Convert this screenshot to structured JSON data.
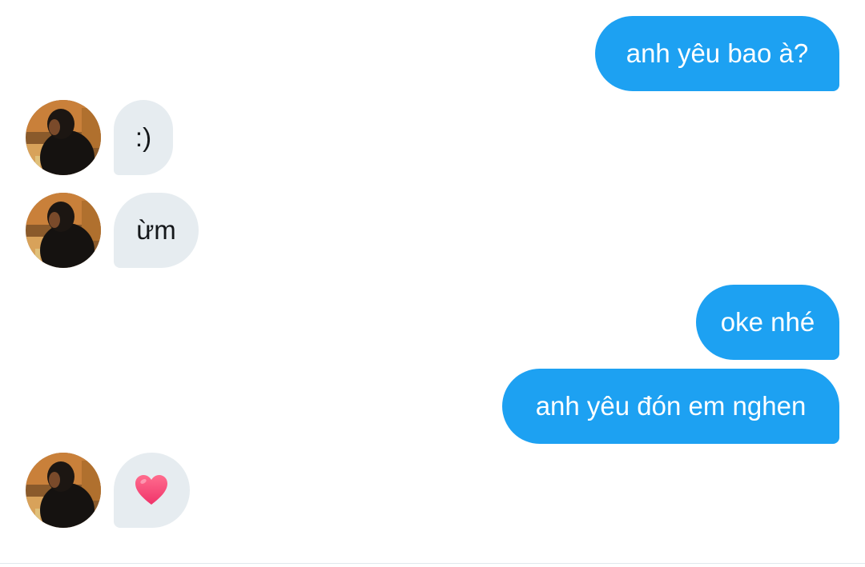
{
  "colors": {
    "sent_bubble": "#1da1f2",
    "sent_text": "#ffffff",
    "received_bubble": "#e6ecf0",
    "received_text": "#14171a",
    "divider": "#e1e8ed"
  },
  "messages": [
    {
      "sender": "me",
      "text": "anh yêu bao à?"
    },
    {
      "sender": "them",
      "text": ":)"
    },
    {
      "sender": "them",
      "text": "ừm"
    },
    {
      "sender": "me",
      "text": "oke nhé"
    },
    {
      "sender": "me",
      "text": "anh yêu đón em nghen"
    },
    {
      "sender": "them",
      "text": "",
      "icon": "heart-icon"
    }
  ],
  "avatars": [
    {
      "icon": "avatar-photo"
    },
    {
      "icon": "avatar-photo"
    },
    {
      "icon": "avatar-photo"
    }
  ]
}
